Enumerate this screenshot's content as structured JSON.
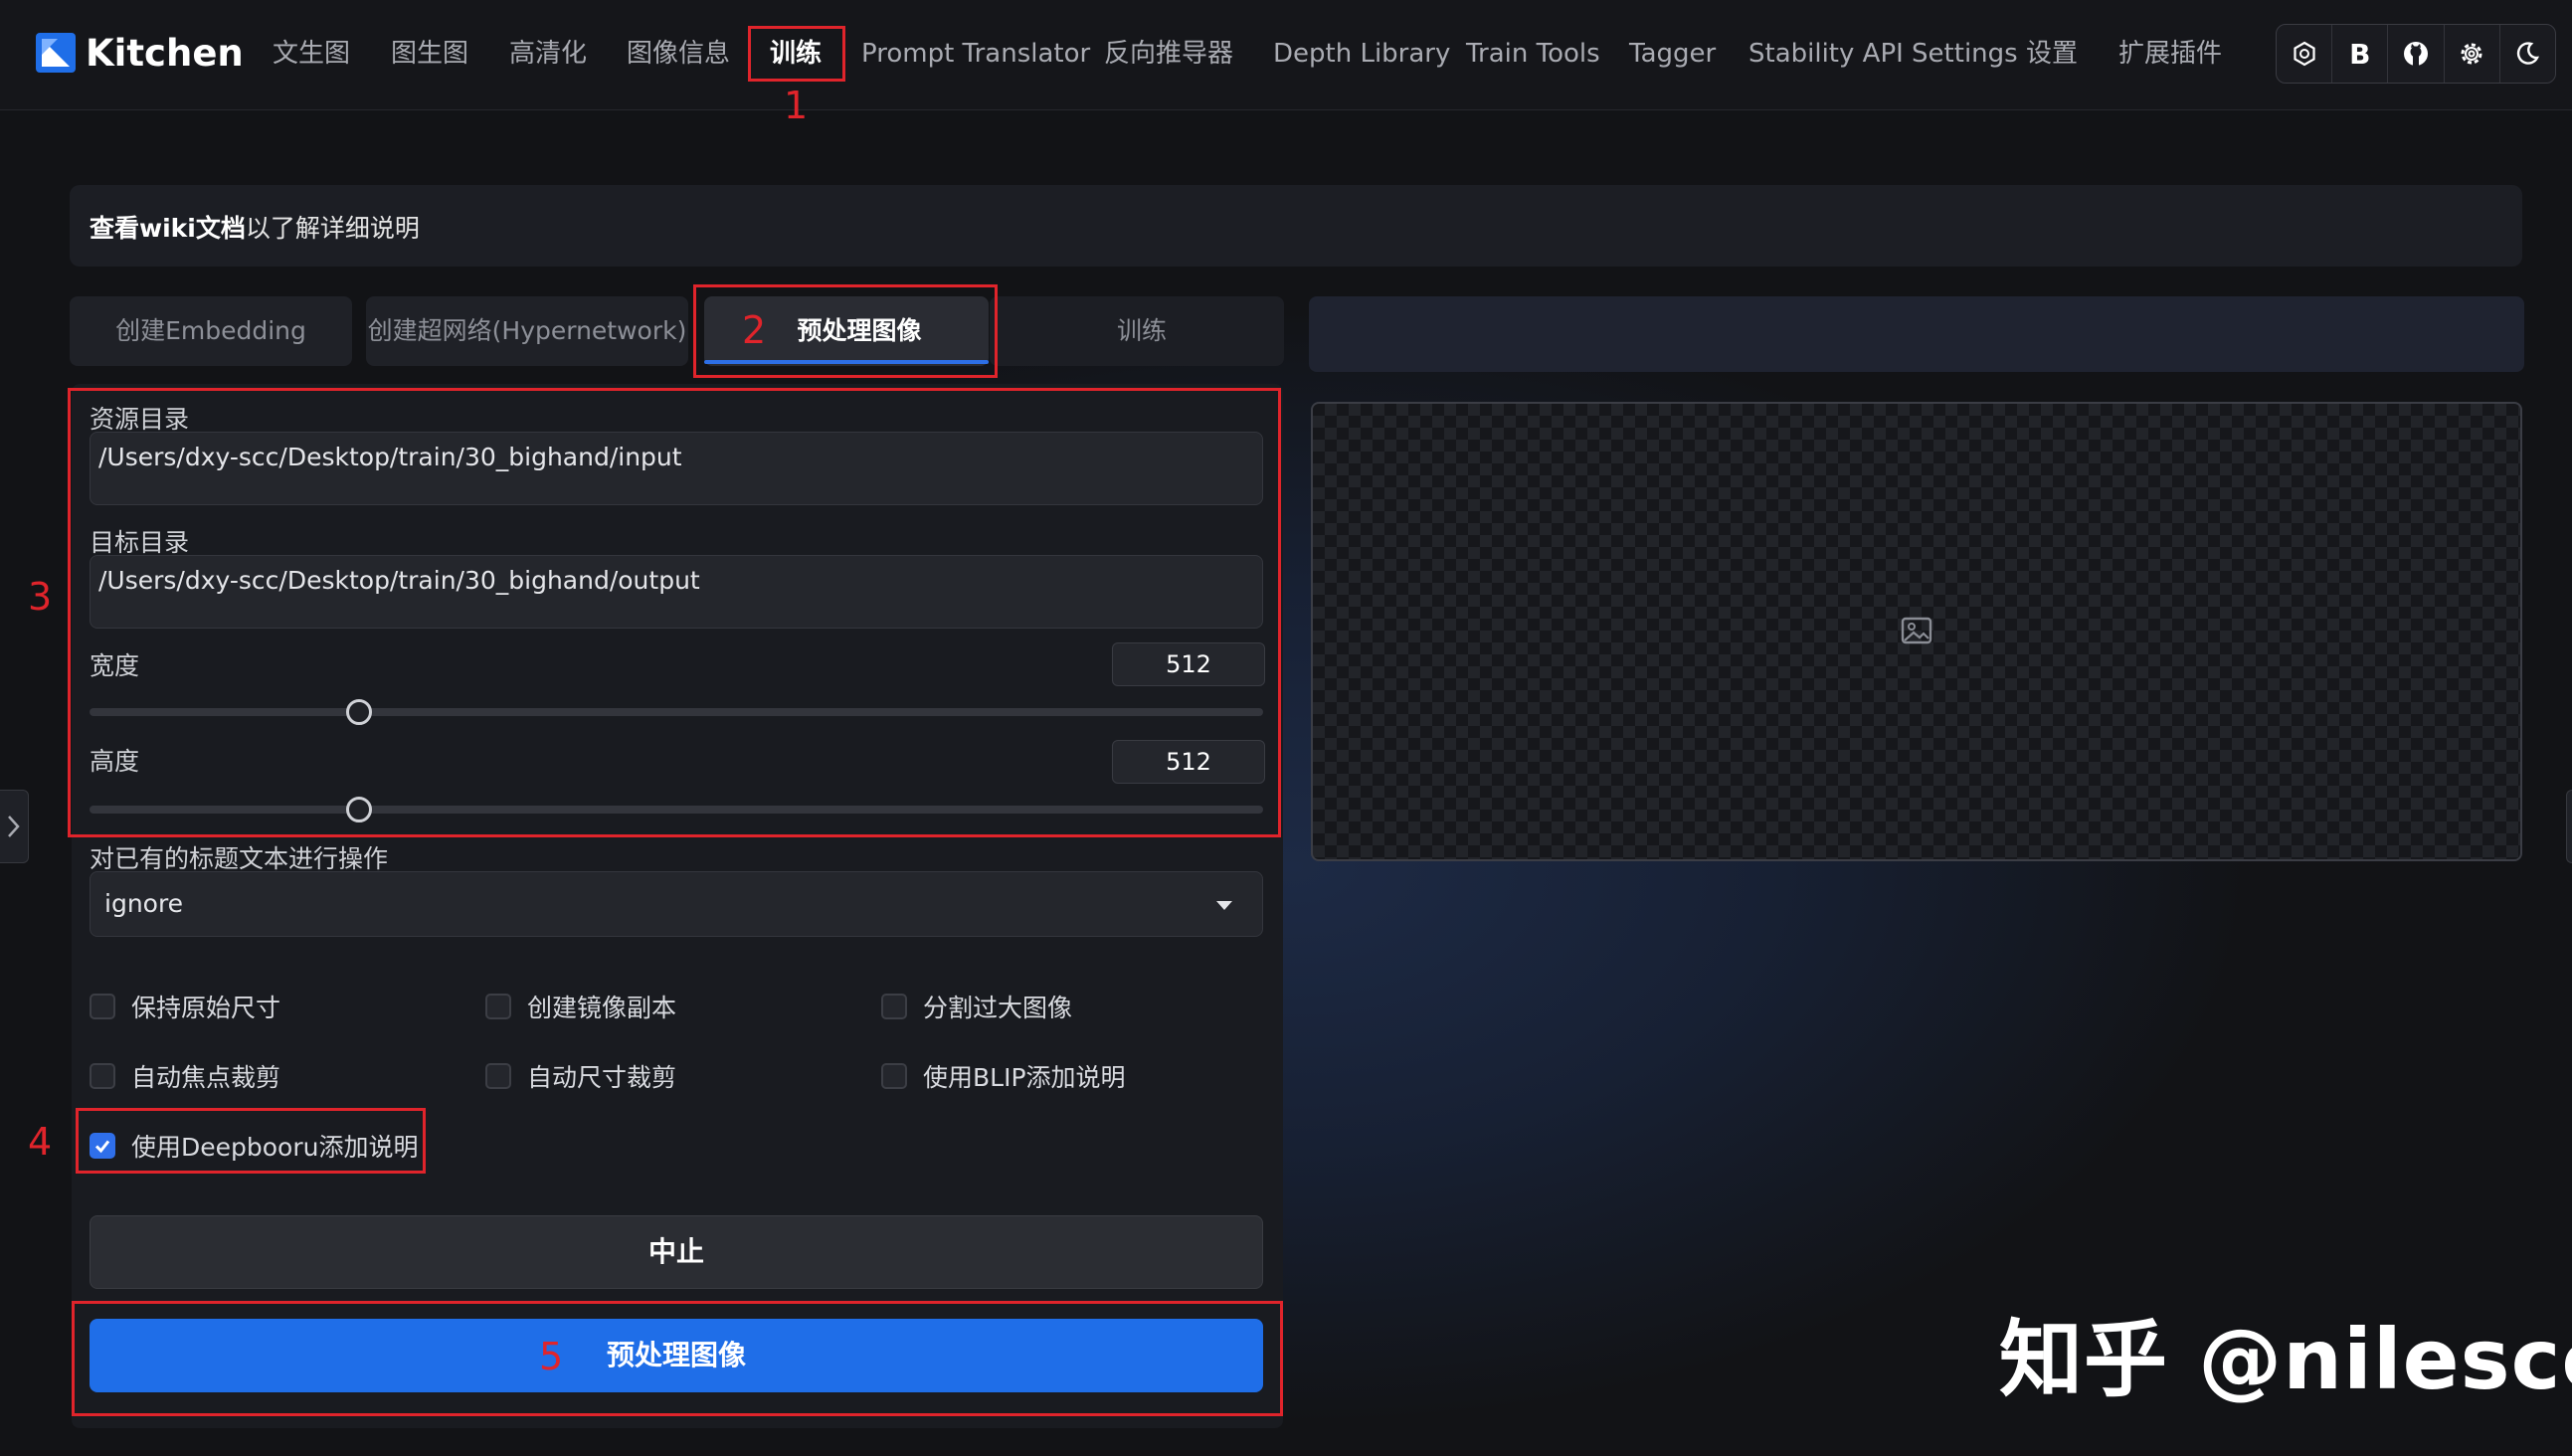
{
  "app": {
    "title": "Kitchen"
  },
  "nav": {
    "items": [
      {
        "label": "文生图"
      },
      {
        "label": "图生图"
      },
      {
        "label": "高清化"
      },
      {
        "label": "图像信息"
      },
      {
        "label": "训练"
      },
      {
        "label": "Prompt Translator"
      },
      {
        "label": "反向推导器"
      },
      {
        "label": "Depth Library"
      },
      {
        "label": "Train Tools"
      },
      {
        "label": "Tagger"
      },
      {
        "label": "Stability API Settings"
      },
      {
        "label": "设置"
      },
      {
        "label": "扩展插件"
      }
    ],
    "active": "训练",
    "icons": [
      "openai-icon",
      "bold-b-icon",
      "github-icon",
      "settings-gear-icon",
      "dark-mode-moon-icon"
    ]
  },
  "info": {
    "link_text": "查看wiki文档",
    "rest_text": "以了解详细说明"
  },
  "tabs": [
    {
      "label": "创建Embedding"
    },
    {
      "label": "创建超网络(Hypernetwork)"
    },
    {
      "label": "预处理图像"
    },
    {
      "label": "训练"
    }
  ],
  "form": {
    "source_dir": {
      "label": "资源目录",
      "value": "/Users/dxy-scc/Desktop/train/30_bighand/input"
    },
    "target_dir": {
      "label": "目标目录",
      "value": "/Users/dxy-scc/Desktop/train/30_bighand/output"
    },
    "width": {
      "label": "宽度",
      "value": "512",
      "fraction": 0.23
    },
    "height": {
      "label": "高度",
      "value": "512",
      "fraction": 0.23
    },
    "caption_action": {
      "label": "对已有的标题文本进行操作",
      "value": "ignore"
    },
    "checkboxes": {
      "keep_original_size": {
        "label": "保持原始尺寸",
        "checked": false
      },
      "create_flipped": {
        "label": "创建镜像副本",
        "checked": false
      },
      "split_oversized": {
        "label": "分割过大图像",
        "checked": false
      },
      "auto_focal_crop": {
        "label": "自动焦点裁剪",
        "checked": false
      },
      "auto_size_crop": {
        "label": "自动尺寸裁剪",
        "checked": false
      },
      "use_blip": {
        "label": "使用BLIP添加说明",
        "checked": false
      },
      "use_deepbooru": {
        "label": "使用Deepbooru添加说明",
        "checked": true
      }
    },
    "stop_button": "中止",
    "preprocess_button": "预处理图像"
  },
  "annotations": [
    "1",
    "2",
    "3",
    "4",
    "5"
  ],
  "colors": {
    "accent": "#1f6ee8",
    "annotation": "#e0242b",
    "background": "#121316"
  },
  "watermark": "知乎 @nilescc"
}
